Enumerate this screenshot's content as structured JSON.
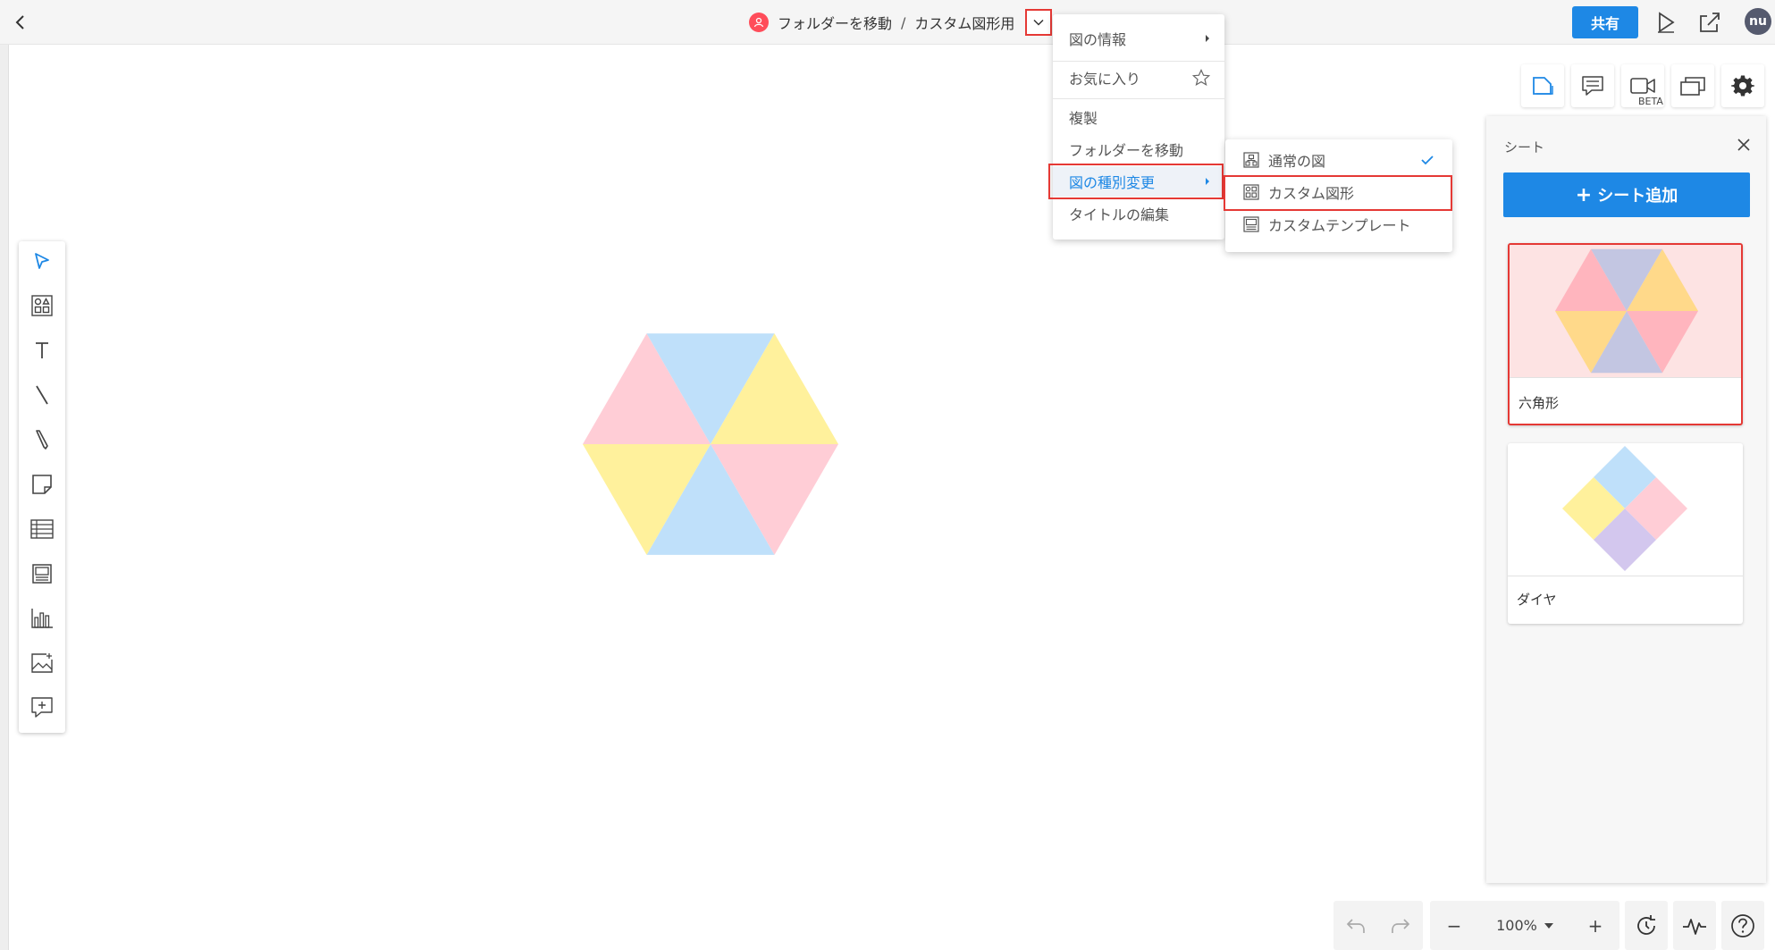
{
  "header": {
    "breadcrumb_folder": "フォルダーを移動",
    "breadcrumb_sep": "/",
    "breadcrumb_title": "カスタム図形用",
    "share_label": "共有",
    "avatar_text": "nu"
  },
  "title_menu": {
    "items": [
      {
        "label": "図の情報"
      },
      {
        "label": "お気に入り"
      },
      {
        "label": "複製"
      },
      {
        "label": "フォルダーを移動"
      },
      {
        "label": "図の種別変更"
      },
      {
        "label": "タイトルの編集"
      }
    ]
  },
  "type_submenu": {
    "items": [
      {
        "label": "通常の図",
        "checked": true
      },
      {
        "label": "カスタム図形",
        "checked": false
      },
      {
        "label": "カスタムテンプレート",
        "checked": false
      }
    ]
  },
  "right_tools": {
    "beta_label": "BETA"
  },
  "sheet_panel": {
    "title": "シート",
    "add_button": "シート追加",
    "add_symbol": "+",
    "sheets": [
      {
        "name": "六角形",
        "active": true
      },
      {
        "name": "ダイヤ",
        "active": false
      }
    ]
  },
  "bottom": {
    "zoom": "100%",
    "minus": "−",
    "plus": "+"
  },
  "colors": {
    "accent": "#1e88e5",
    "highlight": "#e53935",
    "pink": "#ffcdd6",
    "blue": "#bfe0fa",
    "yellow": "#fff19c",
    "purple": "#d3c7ee"
  }
}
